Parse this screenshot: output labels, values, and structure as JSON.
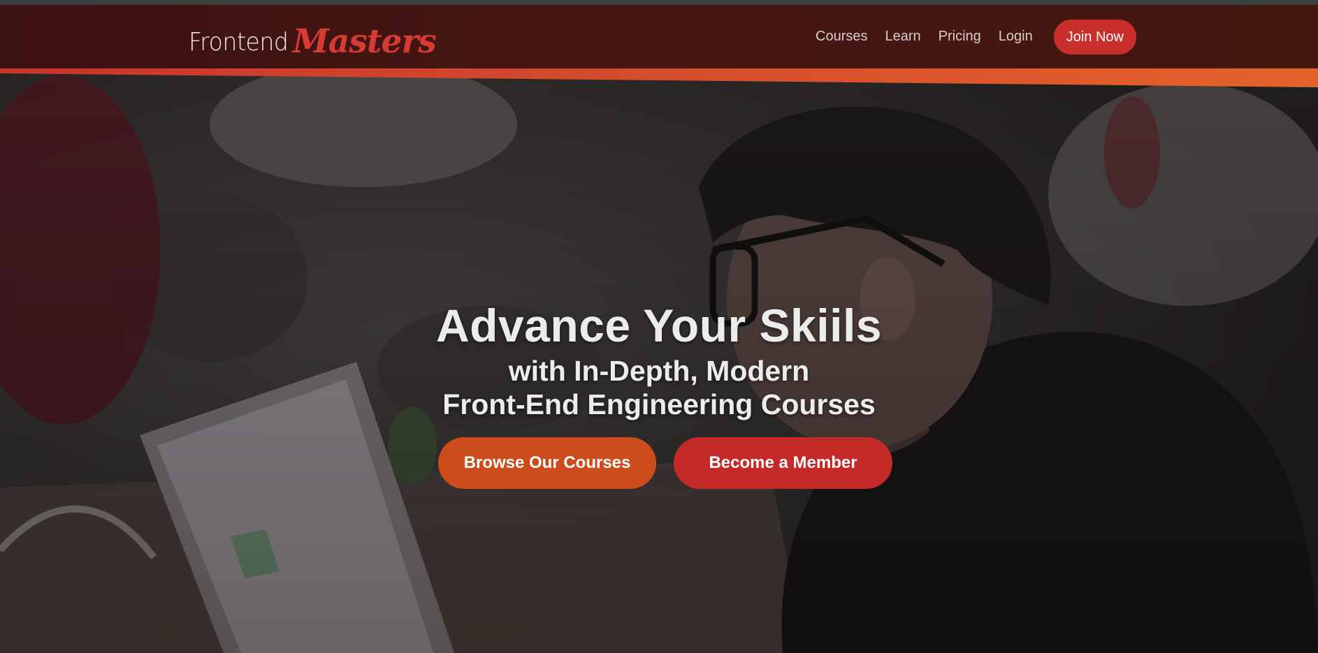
{
  "header": {
    "logo_frontend": "Frontend",
    "logo_masters": "Masters",
    "nav": {
      "courses": "Courses",
      "learn": "Learn",
      "pricing": "Pricing",
      "login": "Login",
      "join": "Join Now"
    }
  },
  "hero": {
    "title": "Advance Your Skiils",
    "subtitle_line1": "with In-Depth, Modern",
    "subtitle_line2": "Front-End Engineering Courses",
    "browse_button": "Browse Our Courses",
    "member_button": "Become a Member"
  },
  "colors": {
    "brand_red": "#c9302c",
    "accent_orange": "#cc4d1b",
    "header_bg": "#431513"
  }
}
